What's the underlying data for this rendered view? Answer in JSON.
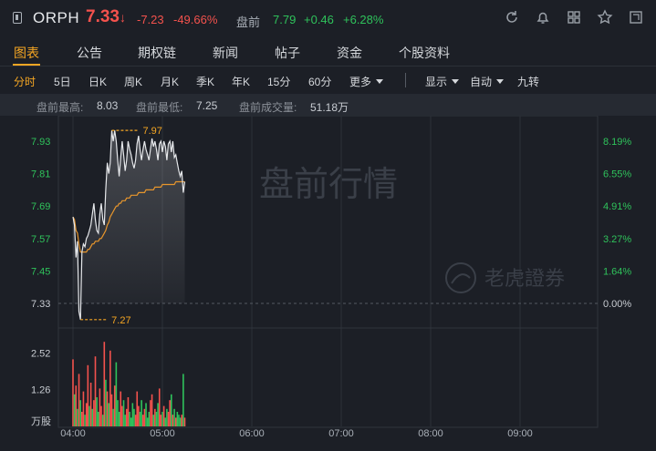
{
  "header": {
    "ticker": "ORPH",
    "price": "7.33",
    "price_arrow": "↓",
    "change": "-7.23",
    "change_pct": "-49.66%",
    "premarket_label": "盘前",
    "premarket_price": "7.79",
    "premarket_change": "+0.46",
    "premarket_change_pct": "+6.28%",
    "icons": [
      "document-icon",
      "refresh-icon",
      "bell-icon",
      "grid-icon",
      "star-icon",
      "expand-icon"
    ]
  },
  "tabs": [
    "图表",
    "公告",
    "期权链",
    "新闻",
    "帖子",
    "资金",
    "个股资料"
  ],
  "active_tab": "图表",
  "toolbar": {
    "periods": [
      "分时",
      "5日",
      "日K",
      "周K",
      "月K",
      "季K",
      "年K",
      "15分",
      "60分",
      "更多"
    ],
    "active_period": "分时",
    "display_label": "显示",
    "auto_label": "自动",
    "nine_turn_label": "九转"
  },
  "stats": {
    "high_label": "盘前最高:",
    "high_value": "8.03",
    "low_label": "盘前最低:",
    "low_value": "7.25",
    "volume_label": "盘前成交量:",
    "volume_value": "51.18万"
  },
  "watermark": {
    "title": "盘前行情",
    "brand": "老虎證券"
  },
  "colors": {
    "up": "#f4524d",
    "down": "#2fc25b",
    "accent": "#f5a623",
    "avg_line": "#e8962c",
    "price_line": "#e6e8eb"
  },
  "chart_data": {
    "type": "line",
    "y_ticks_left": [
      "7.93",
      "7.81",
      "7.69",
      "7.57",
      "7.45",
      "7.33"
    ],
    "y_ticks_right": [
      "8.19%",
      "6.55%",
      "4.91%",
      "3.27%",
      "1.64%",
      "0.00%"
    ],
    "ylim": [
      7.27,
      7.99
    ],
    "x_ticks": [
      "04:00",
      "05:00",
      "06:00",
      "07:00",
      "08:00",
      "09:00"
    ],
    "x_range_minutes": [
      0,
      330
    ],
    "high_marker": "7.97",
    "low_marker": "7.27",
    "volume_ticks": [
      "2.52",
      "1.26"
    ],
    "volume_unit": "万股",
    "volume_max": 3.0,
    "series": [
      {
        "minutes": [
          0,
          1,
          2,
          3,
          4,
          5,
          6,
          7,
          8,
          9,
          10,
          11,
          12,
          13,
          14,
          15,
          16,
          17,
          18,
          19,
          20,
          21,
          22,
          23,
          24,
          25,
          26,
          27,
          28,
          29,
          30,
          31,
          32,
          33,
          34,
          35,
          36,
          37,
          38,
          39,
          40,
          41,
          42,
          43,
          44,
          45,
          46,
          47,
          48,
          49,
          50,
          51,
          52,
          53,
          54,
          55,
          56,
          57,
          58,
          59,
          60,
          61,
          62,
          63,
          64,
          65,
          66,
          67,
          68,
          69,
          70,
          71,
          72,
          73,
          74,
          75
        ],
        "price": [
          7.65,
          7.62,
          7.5,
          7.56,
          7.3,
          7.27,
          7.52,
          7.55,
          7.54,
          7.57,
          7.58,
          7.6,
          7.62,
          7.66,
          7.7,
          7.64,
          7.6,
          7.59,
          7.66,
          7.7,
          7.64,
          7.62,
          7.75,
          7.85,
          7.81,
          7.85,
          7.97,
          7.93,
          7.97,
          7.93,
          7.86,
          7.8,
          7.87,
          7.93,
          7.88,
          7.82,
          7.86,
          7.93,
          7.9,
          7.88,
          7.85,
          7.83,
          7.86,
          7.92,
          7.95,
          7.9,
          7.86,
          7.9,
          7.93,
          7.9,
          7.88,
          7.86,
          7.9,
          7.94,
          7.91,
          7.93,
          7.9,
          7.86,
          7.92,
          7.93,
          7.89,
          7.93,
          7.91,
          7.86,
          7.92,
          7.93,
          7.89,
          7.93,
          7.87,
          7.88,
          7.85,
          7.82,
          7.8,
          7.82,
          7.74,
          7.78
        ],
        "avg": [
          7.65,
          7.64,
          7.6,
          7.59,
          7.55,
          7.52,
          7.52,
          7.52,
          7.52,
          7.52,
          7.53,
          7.53,
          7.54,
          7.55,
          7.55,
          7.56,
          7.56,
          7.56,
          7.57,
          7.57,
          7.58,
          7.59,
          7.6,
          7.62,
          7.63,
          7.65,
          7.66,
          7.67,
          7.68,
          7.69,
          7.69,
          7.7,
          7.7,
          7.71,
          7.71,
          7.71,
          7.72,
          7.72,
          7.72,
          7.73,
          7.73,
          7.73,
          7.73,
          7.73,
          7.74,
          7.74,
          7.74,
          7.74,
          7.74,
          7.75,
          7.75,
          7.75,
          7.75,
          7.75,
          7.75,
          7.76,
          7.76,
          7.76,
          7.76,
          7.76,
          7.77,
          7.77,
          7.77,
          7.77,
          7.77,
          7.77,
          7.77,
          7.77,
          7.77,
          7.78,
          7.78,
          7.78,
          7.78,
          7.78,
          7.78,
          7.78
        ],
        "volume": [
          2.3,
          1.1,
          1.4,
          0.6,
          1.8,
          0.9,
          0.5,
          1.2,
          0.4,
          0.8,
          2.1,
          0.7,
          1.5,
          0.6,
          0.9,
          2.4,
          1.0,
          0.5,
          1.3,
          0.7,
          0.4,
          2.9,
          1.6,
          1.2,
          0.8,
          2.6,
          1.1,
          0.6,
          1.4,
          2.2,
          0.9,
          0.5,
          1.2,
          0.7,
          0.9,
          0.4,
          0.6,
          1.0,
          0.5,
          0.3,
          0.8,
          0.6,
          0.4,
          1.2,
          0.7,
          0.5,
          0.9,
          0.4,
          0.6,
          0.8,
          0.3,
          0.5,
          0.9,
          1.1,
          0.4,
          0.6,
          0.5,
          0.8,
          1.3,
          0.4,
          0.5,
          0.7,
          0.3,
          0.6,
          0.5,
          0.9,
          1.1,
          0.4,
          0.6,
          0.3,
          0.5,
          0.4,
          0.3,
          0.4,
          1.8,
          0.3
        ],
        "volume_up": [
          true,
          false,
          true,
          false,
          true,
          false,
          true,
          true,
          false,
          true,
          true,
          false,
          true,
          false,
          true,
          true,
          false,
          false,
          true,
          true,
          false,
          true,
          false,
          true,
          false,
          true,
          true,
          false,
          true,
          false,
          false,
          false,
          true,
          true,
          false,
          false,
          true,
          true,
          false,
          false,
          false,
          false,
          true,
          true,
          true,
          false,
          false,
          true,
          true,
          false,
          false,
          false,
          true,
          true,
          false,
          true,
          false,
          false,
          true,
          true,
          false,
          true,
          false,
          false,
          true,
          true,
          false,
          true,
          false,
          true,
          false,
          false,
          false,
          true,
          false,
          true
        ]
      }
    ]
  }
}
